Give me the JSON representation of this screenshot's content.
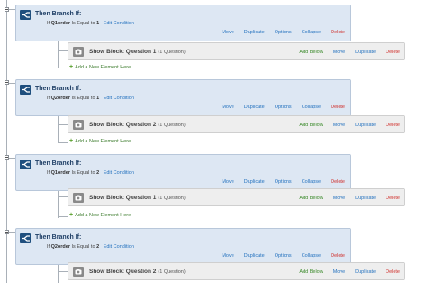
{
  "branches": [
    {
      "title": "Then Branch If:",
      "if_label": "If",
      "question": "Q1order",
      "operator": "Is Equal to",
      "value": "1",
      "edit_label": "Edit Condition",
      "actions": {
        "move": "Move",
        "duplicate": "Duplicate",
        "options": "Options",
        "collapse": "Collapse",
        "delete": "Delete"
      },
      "block": {
        "title": "Show Block: Question 1",
        "count": "(1 Question)",
        "actions": {
          "add_below": "Add Below",
          "move": "Move",
          "duplicate": "Duplicate",
          "delete": "Delete"
        }
      },
      "add_new": "Add a New Element Here"
    },
    {
      "title": "Then Branch If:",
      "if_label": "If",
      "question": "Q2order",
      "operator": "Is Equal to",
      "value": "1",
      "edit_label": "Edit Condition",
      "actions": {
        "move": "Move",
        "duplicate": "Duplicate",
        "options": "Options",
        "collapse": "Collapse",
        "delete": "Delete"
      },
      "block": {
        "title": "Show Block: Question 2",
        "count": "(1 Question)",
        "actions": {
          "add_below": "Add Below",
          "move": "Move",
          "duplicate": "Duplicate",
          "delete": "Delete"
        }
      },
      "add_new": "Add a New Element Here"
    },
    {
      "title": "Then Branch If:",
      "if_label": "If",
      "question": "Q1order",
      "operator": "Is Equal to",
      "value": "2",
      "edit_label": "Edit Condition",
      "actions": {
        "move": "Move",
        "duplicate": "Duplicate",
        "options": "Options",
        "collapse": "Collapse",
        "delete": "Delete"
      },
      "block": {
        "title": "Show Block: Question 1",
        "count": "(1 Question)",
        "actions": {
          "add_below": "Add Below",
          "move": "Move",
          "duplicate": "Duplicate",
          "delete": "Delete"
        }
      },
      "add_new": "Add a New Element Here"
    },
    {
      "title": "Then Branch If:",
      "if_label": "If",
      "question": "Q2order",
      "operator": "Is Equal to",
      "value": "2",
      "edit_label": "Edit Condition",
      "actions": {
        "move": "Move",
        "duplicate": "Duplicate",
        "options": "Options",
        "collapse": "Collapse",
        "delete": "Delete"
      },
      "block": {
        "title": "Show Block: Question 2",
        "count": "(1 Question)",
        "actions": {
          "add_below": "Add Below",
          "move": "Move",
          "duplicate": "Duplicate",
          "delete": "Delete"
        }
      },
      "add_new": "Add a New Element Here"
    }
  ],
  "colors": {
    "branch_bg": "#dde7f3",
    "branch_icon": "#1f4f7e",
    "link": "#2673bf",
    "add_below": "#3a8a2a",
    "delete": "#d0312d",
    "block_bg": "#eeeeee"
  },
  "icons": {
    "branch": "branch-icon",
    "block": "block-icon",
    "collapse": "minus-square-icon",
    "add": "plus-icon"
  }
}
